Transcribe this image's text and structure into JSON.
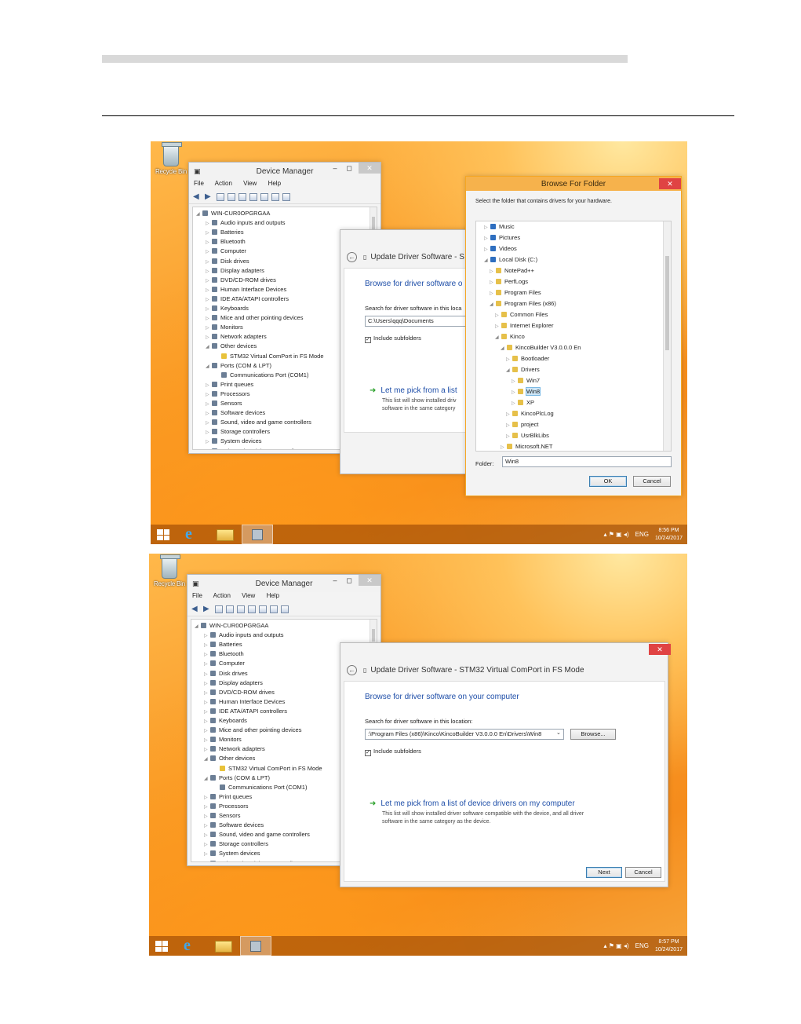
{
  "device_tree": [
    "WIN-CUR0OPGRGAA",
    "Audio inputs and outputs",
    "Batteries",
    "Bluetooth",
    "Computer",
    "Disk drives",
    "Display adapters",
    "DVD/CD-ROM drives",
    "Human Interface Devices",
    "IDE ATA/ATAPI controllers",
    "Keyboards",
    "Mice and other pointing devices",
    "Monitors",
    "Network adapters",
    "Other devices",
    "STM32 Virtual ComPort in FS Mode",
    "Ports (COM & LPT)",
    "Communications Port (COM1)",
    "Print queues",
    "Processors",
    "Sensors",
    "Software devices",
    "Sound, video and game controllers",
    "Storage controllers",
    "System devices",
    "Universal Serial Bus controllers"
  ],
  "dm": {
    "title": "Device Manager",
    "menu_file": "File",
    "menu_action": "Action",
    "menu_view": "View",
    "menu_help": "Help"
  },
  "desktop": {
    "recycle": "Recycle Bin"
  },
  "shot1": {
    "upd_title": "Update Driver Software - S",
    "upd_heading": "Browse for driver software o",
    "upd_search": "Search for driver software in this loca",
    "upd_path": "C:\\Users\\qqq\\Documents",
    "upd_chk": "Include subfolders",
    "upd_link": "Let me pick from a list",
    "upd_desc1": "This list will show installed driv",
    "upd_desc2": "software in the same category",
    "bf_title": "Browse For Folder",
    "bf_prompt": "Select the folder that contains drivers for your hardware.",
    "bf_tree": [
      "Music",
      "Pictures",
      "Videos",
      "Local Disk (C:)",
      "NotePad++",
      "PerfLogs",
      "Program Files",
      "Program Files (x86)",
      "Common Files",
      "Internet Explorer",
      "Kinco",
      "KincoBuilder V3.0.0.0 En",
      "Bootloader",
      "Drivers",
      "Win7",
      "Win8",
      "XP",
      "KincoPlcLog",
      "project",
      "UsrBlkLibs",
      "Microsoft.NET"
    ],
    "bf_folder_label": "Folder:",
    "bf_folder_value": "Win8",
    "bf_ok": "OK",
    "bf_cancel": "Cancel",
    "lang": "ENG",
    "time": "8:56 PM",
    "date": "10/24/2017"
  },
  "shot2": {
    "upd_title": "Update Driver Software - STM32 Virtual ComPort in FS Mode",
    "upd_heading": "Browse for driver software on your computer",
    "upd_search": "Search for driver software in this location:",
    "upd_path": ":\\Program Files (x86)\\Kinco\\KincoBuilder V3.0.0.0 En\\Drivers\\Win8",
    "upd_browse": "Browse...",
    "upd_chk": "Include subfolders",
    "upd_link": "Let me pick from a list of device drivers on my computer",
    "upd_desc1": "This list will show installed driver software compatible with the device, and all driver",
    "upd_desc2": "software in the same category as the device.",
    "upd_next": "Next",
    "upd_cancel": "Cancel",
    "lang": "ENG",
    "time": "8:57 PM",
    "date": "10/24/2017"
  }
}
